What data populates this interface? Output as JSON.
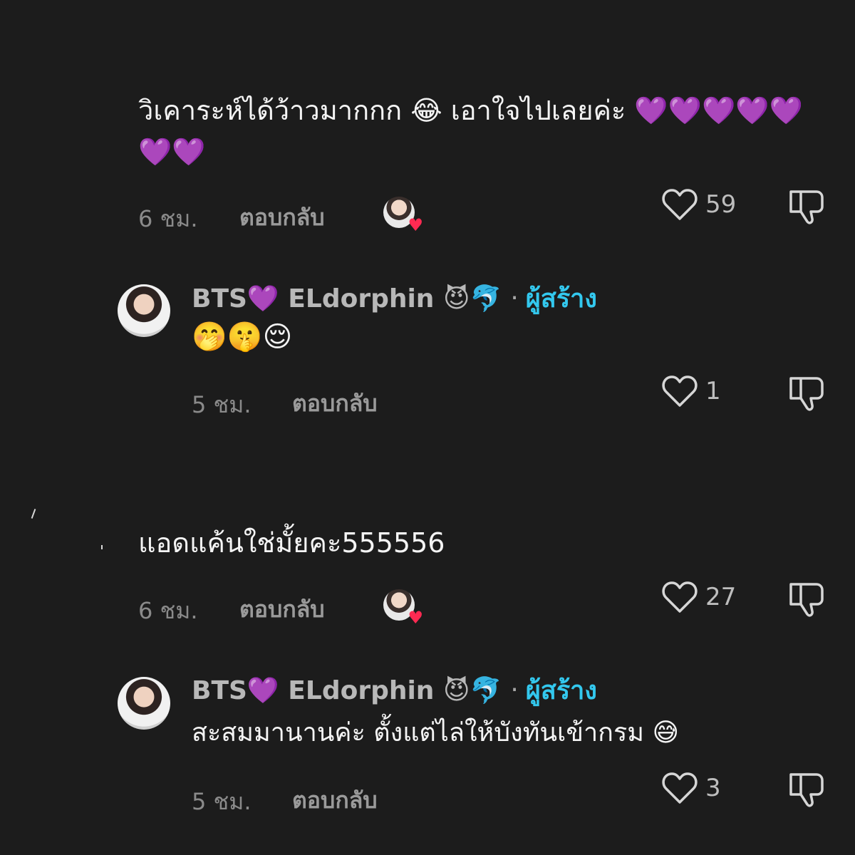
{
  "comments": [
    {
      "text": "วิเคาระห์ได้ว้าวมากกก 😂 เอาใจไปเลยค่ะ 💜💜💜💜💜💜💜",
      "time": "6 ชม.",
      "reply_label": "ตอบกลับ",
      "like_count": "59",
      "reply": {
        "username": "BTS💜 ELdorphin 😈🐬",
        "creator_label": "ผู้สร้าง",
        "text": "🤭🤫😌",
        "time": "5 ชม.",
        "reply_label": "ตอบกลับ",
        "like_count": "1"
      }
    },
    {
      "text": "แอดแค้นใช่มั้ยคะ555556",
      "time": "6 ชม.",
      "reply_label": "ตอบกลับ",
      "like_count": "27",
      "reply": {
        "username": "BTS💜 ELdorphin 😈🐬",
        "creator_label": "ผู้สร้าง",
        "text": "สะสมมานานค่ะ ตั้งแต่ไล่ให้บังทันเข้ากรม 😅",
        "time": "5 ชม.",
        "reply_label": "ตอบกลับ",
        "like_count": "3"
      }
    }
  ],
  "icons": {
    "like": "heart-outline-icon",
    "dislike": "thumbs-down-outline-icon",
    "liked_by_creator": "creator-heart-avatar-icon"
  },
  "colors": {
    "background": "#1c1c1c",
    "creator_badge": "#33c8ee",
    "liked_heart": "#ff2a52"
  }
}
